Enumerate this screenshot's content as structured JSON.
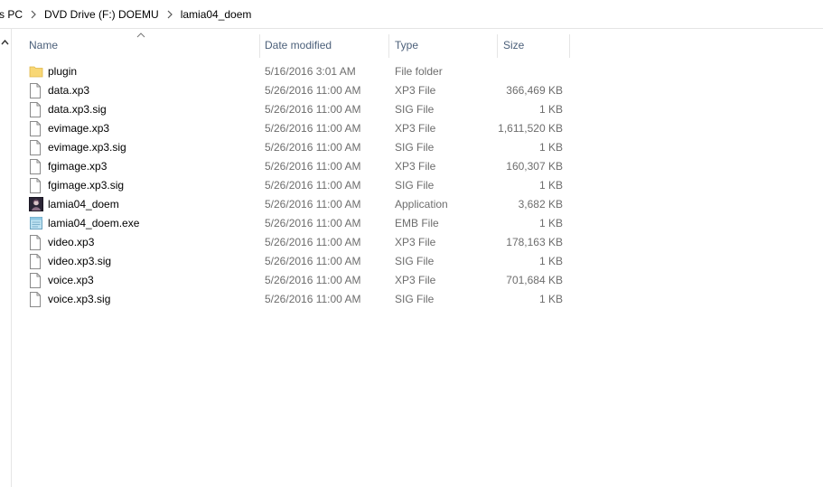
{
  "breadcrumb": {
    "items": [
      "s PC",
      "DVD Drive (F:) DOEMU",
      "lamia04_doem"
    ]
  },
  "columns": {
    "name": "Name",
    "date": "Date modified",
    "type": "Type",
    "size": "Size"
  },
  "files": [
    {
      "name": "plugin",
      "date": "5/16/2016 3:01 AM",
      "type": "File folder",
      "size": "",
      "icon": "folder-icon"
    },
    {
      "name": "data.xp3",
      "date": "5/26/2016 11:00 AM",
      "type": "XP3 File",
      "size": "366,469 KB",
      "icon": "file-icon"
    },
    {
      "name": "data.xp3.sig",
      "date": "5/26/2016 11:00 AM",
      "type": "SIG File",
      "size": "1 KB",
      "icon": "file-icon"
    },
    {
      "name": "evimage.xp3",
      "date": "5/26/2016 11:00 AM",
      "type": "XP3 File",
      "size": "1,611,520 KB",
      "icon": "file-icon"
    },
    {
      "name": "evimage.xp3.sig",
      "date": "5/26/2016 11:00 AM",
      "type": "SIG File",
      "size": "1 KB",
      "icon": "file-icon"
    },
    {
      "name": "fgimage.xp3",
      "date": "5/26/2016 11:00 AM",
      "type": "XP3 File",
      "size": "160,307 KB",
      "icon": "file-icon"
    },
    {
      "name": "fgimage.xp3.sig",
      "date": "5/26/2016 11:00 AM",
      "type": "SIG File",
      "size": "1 KB",
      "icon": "file-icon"
    },
    {
      "name": "lamia04_doem",
      "date": "5/26/2016 11:00 AM",
      "type": "Application",
      "size": "3,682 KB",
      "icon": "application-icon"
    },
    {
      "name": "lamia04_doem.exe",
      "date": "5/26/2016 11:00 AM",
      "type": "EMB File",
      "size": "1 KB",
      "icon": "emb-file-icon"
    },
    {
      "name": "video.xp3",
      "date": "5/26/2016 11:00 AM",
      "type": "XP3 File",
      "size": "178,163 KB",
      "icon": "file-icon"
    },
    {
      "name": "video.xp3.sig",
      "date": "5/26/2016 11:00 AM",
      "type": "SIG File",
      "size": "1 KB",
      "icon": "file-icon"
    },
    {
      "name": "voice.xp3",
      "date": "5/26/2016 11:00 AM",
      "type": "XP3 File",
      "size": "701,684 KB",
      "icon": "file-icon"
    },
    {
      "name": "voice.xp3.sig",
      "date": "5/26/2016 11:00 AM",
      "type": "SIG File",
      "size": "1 KB",
      "icon": "file-icon"
    }
  ],
  "colors": {
    "header_text": "#4c607a",
    "muted_text": "#6d6d6d",
    "folder": "#f8d775",
    "divider": "#e5e5e5"
  }
}
